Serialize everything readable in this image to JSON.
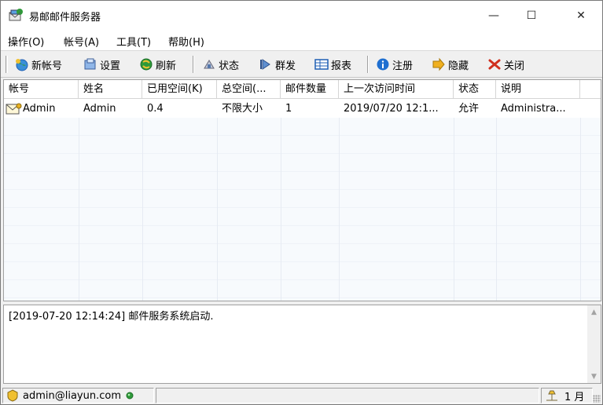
{
  "window": {
    "title": "易邮邮件服务器",
    "min_glyph": "—",
    "max_glyph": "☐",
    "close_glyph": "✕"
  },
  "menu": [
    "操作(O)",
    "帐号(A)",
    "工具(T)",
    "帮助(H)"
  ],
  "toolbar": {
    "new_account": "新帐号",
    "settings": "设置",
    "refresh": "刷新",
    "status": "状态",
    "broadcast": "群发",
    "report": "报表",
    "register": "注册",
    "hide": "隐藏",
    "close": "关闭"
  },
  "table": {
    "columns": [
      "帐号",
      "姓名",
      "已用空间(K)",
      "总空间(...",
      "邮件数量",
      "上一次访问时间",
      "状态",
      "说明"
    ],
    "rows": [
      [
        "Admin",
        "Admin",
        "0.4",
        "不限大小",
        "1",
        "2019/07/20 12:1...",
        "允许",
        "Administra..."
      ]
    ]
  },
  "log": {
    "lines": [
      "[2019-07-20 12:14:24] 邮件服务系统启动."
    ]
  },
  "statusbar": {
    "account": "admin@liayun.com",
    "month": "1 月"
  },
  "colors": {
    "accent_green": "#2f9a3a",
    "icon_blue": "#1f5fb4",
    "close_red": "#d0301e",
    "icon_yellow": "#e8b020"
  }
}
